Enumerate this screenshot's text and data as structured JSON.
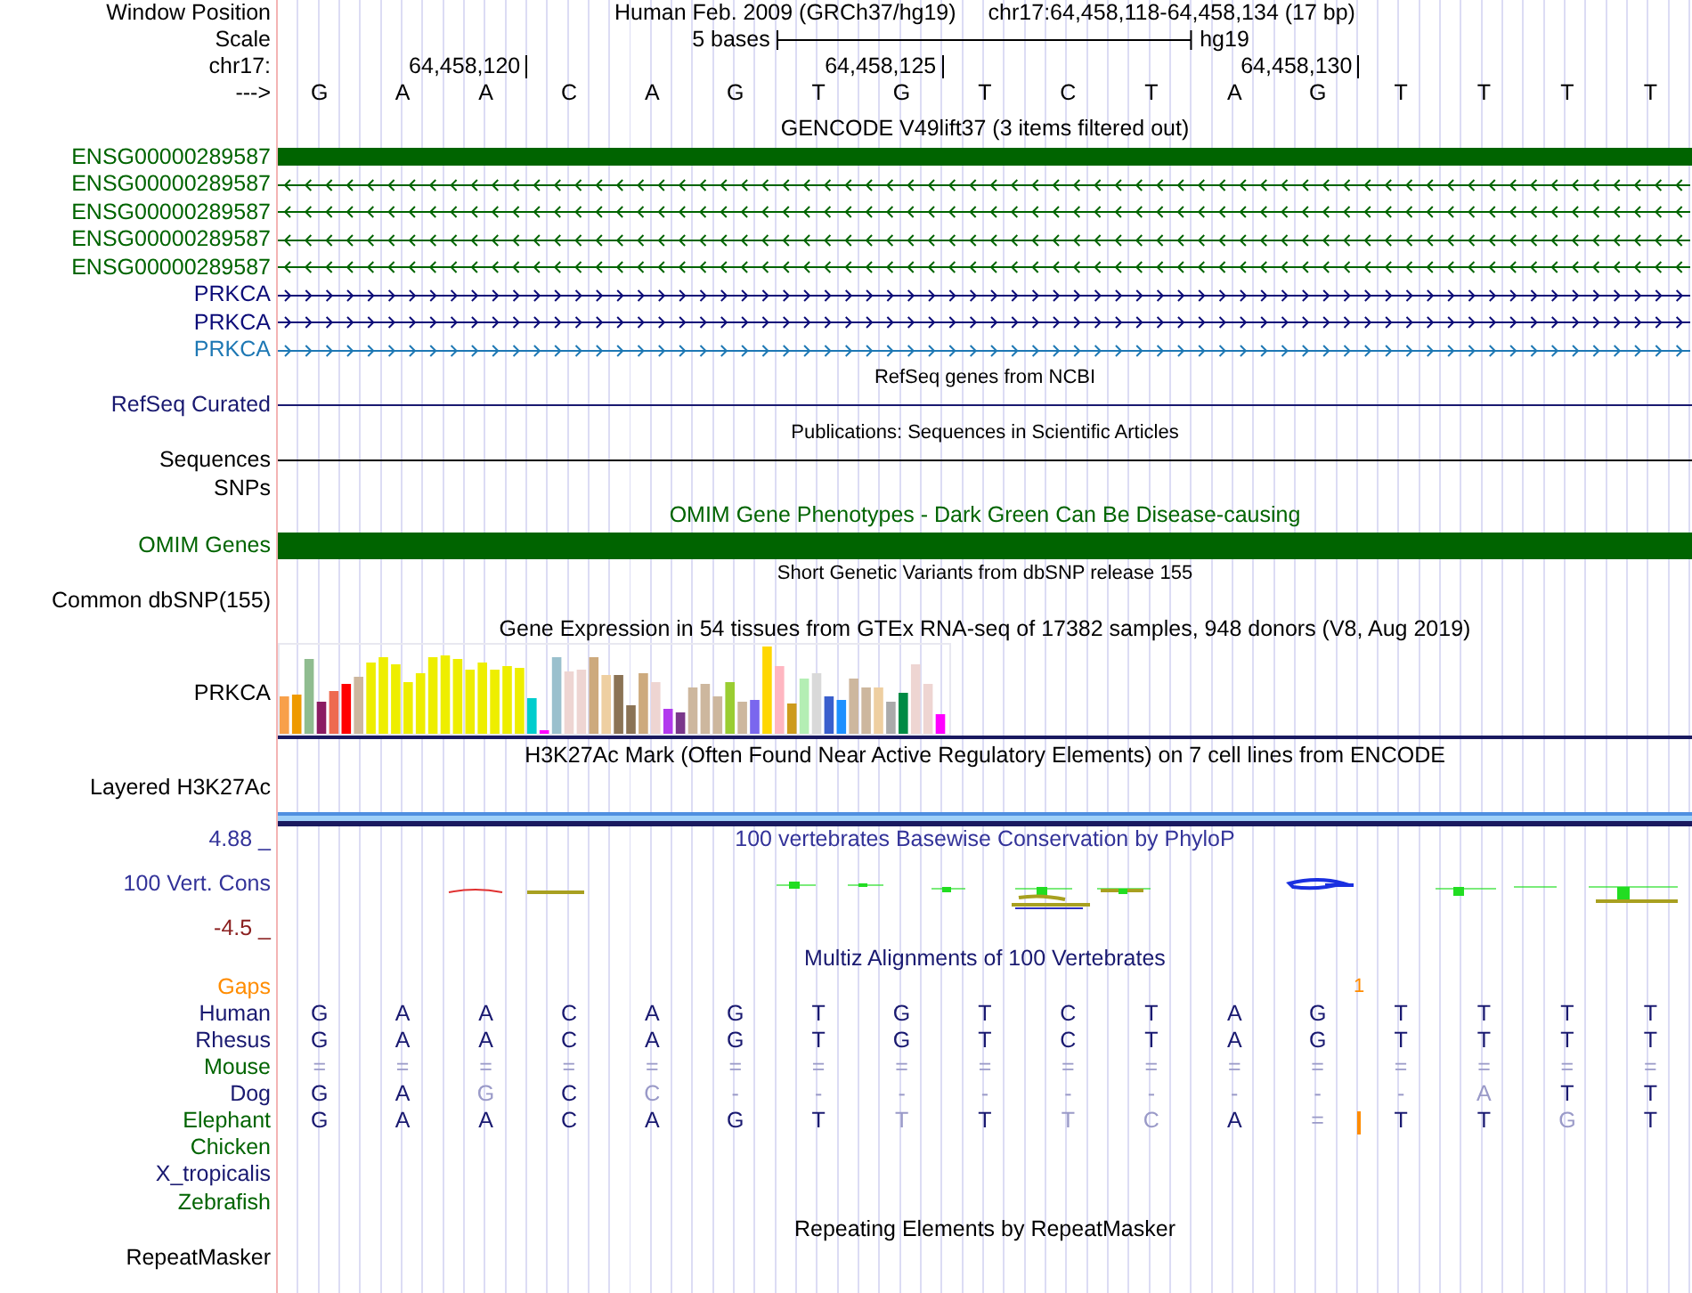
{
  "header": {
    "label": "Window Position",
    "assembly": "Human Feb. 2009 (GRCh37/hg19)",
    "position": "chr17:64,458,118-64,458,134 (17 bp)"
  },
  "scale": {
    "label": "Scale",
    "span": "5 bases",
    "assembly": "hg19"
  },
  "ruler": {
    "label": "chr17:",
    "ticks": [
      "64,458,120",
      "64,458,125",
      "64,458,130"
    ]
  },
  "sequence": {
    "label": "--->",
    "bases": [
      "G",
      "A",
      "A",
      "C",
      "A",
      "G",
      "T",
      "G",
      "T",
      "C",
      "T",
      "A",
      "G",
      "T",
      "T",
      "T",
      "T"
    ]
  },
  "rows": [
    {
      "kind": "title",
      "text": "GENCODE V49lift37 (3 items filtered out)",
      "color": "#000000"
    },
    {
      "kind": "block",
      "label": "ENSG00000289587",
      "color": "#006400"
    },
    {
      "kind": "reverse",
      "label": "ENSG00000289587",
      "color": "#006400"
    },
    {
      "kind": "reverse",
      "label": "ENSG00000289587",
      "color": "#006400"
    },
    {
      "kind": "reverse",
      "label": "ENSG00000289587",
      "color": "#006400"
    },
    {
      "kind": "reverse",
      "label": "ENSG00000289587",
      "color": "#006400"
    },
    {
      "kind": "forward",
      "label": "PRKCA",
      "color": "#0c0c78"
    },
    {
      "kind": "forward",
      "label": "PRKCA",
      "color": "#0c0c78"
    },
    {
      "kind": "forward",
      "label": "PRKCA",
      "color": "#1e78b4"
    },
    {
      "kind": "small_title",
      "text": "RefSeq genes from NCBI",
      "color": "#000000"
    },
    {
      "kind": "line",
      "label": "RefSeq Curated",
      "color": "#191970"
    },
    {
      "kind": "small_title",
      "text": "Publications: Sequences in Scientific Articles",
      "color": "#000000"
    },
    {
      "kind": "line",
      "label": "Sequences",
      "color": "#000000"
    },
    {
      "kind": "label",
      "label": "SNPs",
      "color": "#000000"
    },
    {
      "kind": "title",
      "text": "OMIM Gene Phenotypes - Dark Green Can Be Disease-causing",
      "color": "#006400"
    },
    {
      "kind": "thick",
      "label": "OMIM Genes",
      "color": "#006400"
    },
    {
      "kind": "small_title",
      "text": "Short Genetic Variants from dbSNP release 155",
      "color": "#000000"
    },
    {
      "kind": "label",
      "label": "Common dbSNP(155)",
      "color": "#000000"
    },
    {
      "kind": "title",
      "text": "Gene Expression in 54 tissues from GTEx RNA-seq of 17382 samples, 948 donors (V8, Aug 2019)",
      "color": "#000000"
    },
    {
      "kind": "gtex",
      "label": "PRKCA",
      "color": "#000000"
    },
    {
      "kind": "title",
      "text": "H3K27Ac Mark (Often Found Near Active Regulatory Elements) on 7 cell lines from ENCODE",
      "color": "#000000"
    },
    {
      "kind": "layered",
      "label": "Layered H3K27Ac",
      "color": "#000000"
    },
    {
      "kind": "phylop",
      "title": "100 vertebrates Basewise Conservation by PhyloP",
      "label": "100 Vert. Cons",
      "max": "4.88 _",
      "min": "-4.5 _",
      "color": "#333399"
    },
    {
      "kind": "title",
      "text": "Multiz Alignments of 100 Vertebrates",
      "color": "#191970"
    },
    {
      "kind": "gaps",
      "label": "Gaps",
      "color": "#ff8c00",
      "mark": "1"
    },
    {
      "kind": "alignment",
      "label": "Human",
      "color": "#191970",
      "bases": [
        {
          "b": "G",
          "faint": false
        },
        {
          "b": "A",
          "faint": false
        },
        {
          "b": "A",
          "faint": false
        },
        {
          "b": "C",
          "faint": false
        },
        {
          "b": "A",
          "faint": false
        },
        {
          "b": "G",
          "faint": false
        },
        {
          "b": "T",
          "faint": false
        },
        {
          "b": "G",
          "faint": false
        },
        {
          "b": "T",
          "faint": false
        },
        {
          "b": "C",
          "faint": false
        },
        {
          "b": "T",
          "faint": false
        },
        {
          "b": "A",
          "faint": false
        },
        {
          "b": "G",
          "faint": false
        },
        {
          "b": "T",
          "faint": false
        },
        {
          "b": "T",
          "faint": false
        },
        {
          "b": "T",
          "faint": false
        },
        {
          "b": "T",
          "faint": false
        }
      ]
    },
    {
      "kind": "alignment",
      "label": "Rhesus",
      "color": "#191970",
      "bases": [
        {
          "b": "G",
          "faint": false
        },
        {
          "b": "A",
          "faint": false
        },
        {
          "b": "A",
          "faint": false
        },
        {
          "b": "C",
          "faint": false
        },
        {
          "b": "A",
          "faint": false
        },
        {
          "b": "G",
          "faint": false
        },
        {
          "b": "T",
          "faint": false
        },
        {
          "b": "G",
          "faint": false
        },
        {
          "b": "T",
          "faint": false
        },
        {
          "b": "C",
          "faint": false
        },
        {
          "b": "T",
          "faint": false
        },
        {
          "b": "A",
          "faint": false
        },
        {
          "b": "G",
          "faint": false
        },
        {
          "b": "T",
          "faint": false
        },
        {
          "b": "T",
          "faint": false
        },
        {
          "b": "T",
          "faint": false
        },
        {
          "b": "T",
          "faint": false
        }
      ]
    },
    {
      "kind": "alignment",
      "label": "Mouse",
      "color": "#006400",
      "bases": [
        {
          "b": "=",
          "faint": true
        },
        {
          "b": "=",
          "faint": true
        },
        {
          "b": "=",
          "faint": true
        },
        {
          "b": "=",
          "faint": true
        },
        {
          "b": "=",
          "faint": true
        },
        {
          "b": "=",
          "faint": true
        },
        {
          "b": "=",
          "faint": true
        },
        {
          "b": "=",
          "faint": true
        },
        {
          "b": "=",
          "faint": true
        },
        {
          "b": "=",
          "faint": true
        },
        {
          "b": "=",
          "faint": true
        },
        {
          "b": "=",
          "faint": true
        },
        {
          "b": "=",
          "faint": true
        },
        {
          "b": "=",
          "faint": true
        },
        {
          "b": "=",
          "faint": true
        },
        {
          "b": "=",
          "faint": true
        },
        {
          "b": "=",
          "faint": true
        }
      ]
    },
    {
      "kind": "alignment",
      "label": "Dog",
      "color": "#191970",
      "bases": [
        {
          "b": "G",
          "faint": false
        },
        {
          "b": "A",
          "faint": false
        },
        {
          "b": "G",
          "faint": true
        },
        {
          "b": "C",
          "faint": false
        },
        {
          "b": "C",
          "faint": true
        },
        {
          "b": "-",
          "faint": true
        },
        {
          "b": "-",
          "faint": true
        },
        {
          "b": "-",
          "faint": true
        },
        {
          "b": "-",
          "faint": true
        },
        {
          "b": "-",
          "faint": true
        },
        {
          "b": "-",
          "faint": true
        },
        {
          "b": "-",
          "faint": true
        },
        {
          "b": "-",
          "faint": true
        },
        {
          "b": "-",
          "faint": true
        },
        {
          "b": "A",
          "faint": true
        },
        {
          "b": "T",
          "faint": false
        },
        {
          "b": "T",
          "faint": false
        }
      ]
    },
    {
      "kind": "alignment",
      "label": "Elephant",
      "color": "#006400",
      "bases": [
        {
          "b": "G",
          "faint": false
        },
        {
          "b": "A",
          "faint": false
        },
        {
          "b": "A",
          "faint": false
        },
        {
          "b": "C",
          "faint": false
        },
        {
          "b": "A",
          "faint": false
        },
        {
          "b": "G",
          "faint": false
        },
        {
          "b": "T",
          "faint": false
        },
        {
          "b": "T",
          "faint": true
        },
        {
          "b": "T",
          "faint": false
        },
        {
          "b": "T",
          "faint": true
        },
        {
          "b": "C",
          "faint": true
        },
        {
          "b": "A",
          "faint": false
        },
        {
          "b": "=",
          "faint": true,
          "insertion": true
        },
        {
          "b": "T",
          "faint": false
        },
        {
          "b": "T",
          "faint": false
        },
        {
          "b": "G",
          "faint": true
        },
        {
          "b": "T",
          "faint": false
        }
      ]
    },
    {
      "kind": "label",
      "label": "Chicken",
      "color": "#006400"
    },
    {
      "kind": "label",
      "label": "X_tropicalis",
      "color": "#191970"
    },
    {
      "kind": "label",
      "label": "Zebrafish",
      "color": "#006400"
    },
    {
      "kind": "title",
      "text": "Repeating Elements by RepeatMasker",
      "color": "#000000"
    },
    {
      "kind": "label",
      "label": "RepeatMasker",
      "color": "#000000"
    }
  ]
}
